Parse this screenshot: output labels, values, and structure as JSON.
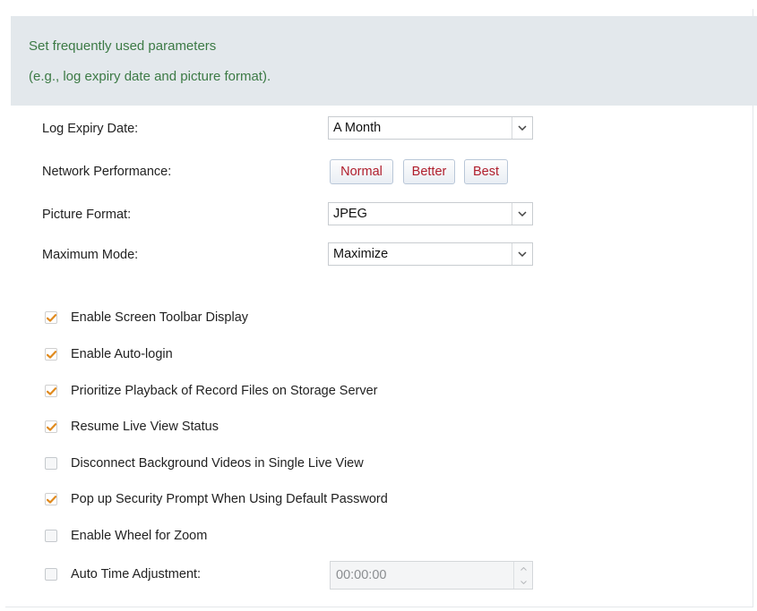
{
  "header": {
    "line1": "Set frequently used parameters",
    "line2": "(e.g., log expiry date and picture format)."
  },
  "settings": {
    "log_expiry": {
      "label": "Log Expiry Date:",
      "value": "A Month"
    },
    "network_performance": {
      "label": "Network Performance:",
      "options": [
        "Normal",
        "Better",
        "Best"
      ]
    },
    "picture_format": {
      "label": "Picture Format:",
      "value": "JPEG"
    },
    "maximum_mode": {
      "label": "Maximum Mode:",
      "value": "Maximize"
    }
  },
  "checkboxes": [
    {
      "label": "Enable Screen Toolbar Display",
      "checked": true
    },
    {
      "label": "Enable Auto-login",
      "checked": true
    },
    {
      "label": "Prioritize Playback of Record Files on Storage Server",
      "checked": true
    },
    {
      "label": "Resume Live View Status",
      "checked": true
    },
    {
      "label": "Disconnect Background Videos in Single Live View",
      "checked": false
    },
    {
      "label": "Pop up Security Prompt When Using Default Password",
      "checked": true
    },
    {
      "label": "Enable Wheel for Zoom",
      "checked": false
    },
    {
      "label": "Auto Time Adjustment:",
      "checked": false
    }
  ],
  "auto_time": {
    "value": "00:00:00"
  },
  "icons": {
    "dropdown": "chevron-down-icon",
    "check": "check-icon",
    "spin_up": "spin-up-icon",
    "spin_down": "spin-down-icon"
  },
  "colors": {
    "hint_text": "#3c7a45",
    "banner_bg": "#e3e8ec",
    "button_text": "#b01e2c",
    "checkmark": "#e08a1e"
  }
}
